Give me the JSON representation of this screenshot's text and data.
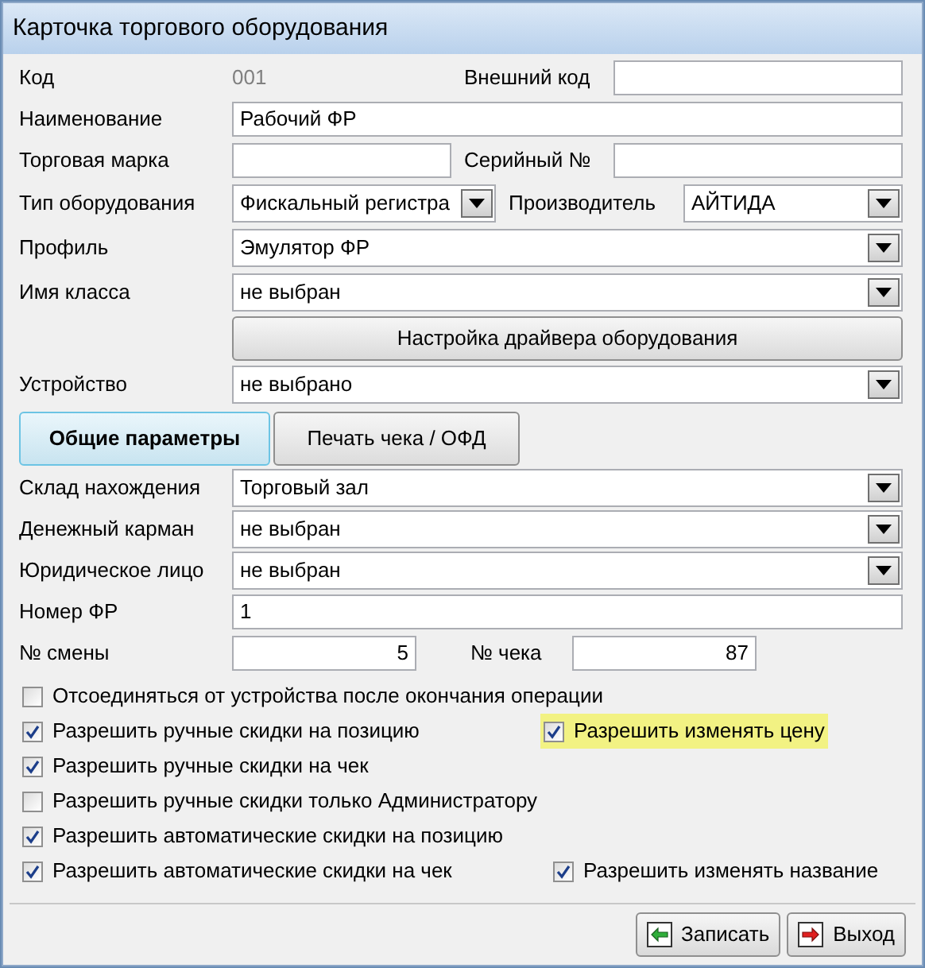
{
  "window": {
    "title": "Карточка торгового оборудования"
  },
  "code": {
    "label": "Код",
    "value": "001"
  },
  "external_code": {
    "label": "Внешний код"
  },
  "name": {
    "label": "Наименование",
    "value": "Рабочий ФР"
  },
  "brand": {
    "label": "Торговая марка"
  },
  "serial": {
    "label": "Серийный №"
  },
  "equipment_type": {
    "label": "Тип оборудования",
    "value": "Фискальный регистра"
  },
  "manufacturer": {
    "label": "Производитель",
    "value": "АЙТИДА"
  },
  "profile": {
    "label": "Профиль",
    "value": "Эмулятор ФР"
  },
  "class_name": {
    "label": "Имя класса",
    "value": "не выбран"
  },
  "driver_button": {
    "label": "Настройка драйвера оборудования"
  },
  "device": {
    "label": "Устройство",
    "value": "не выбрано"
  },
  "tabs": [
    {
      "label": "Общие параметры",
      "selected": true
    },
    {
      "label": "Печать чека / ОФД",
      "selected": false
    }
  ],
  "selects": [
    {
      "label": "Склад нахождения",
      "value": "Торговый зал"
    },
    {
      "label": "Денежный карман",
      "value": "не выбран"
    },
    {
      "label": "Юридическое лицо",
      "value": "не выбран"
    }
  ],
  "fr_number": {
    "label": "Номер ФР",
    "value": "1"
  },
  "shift": {
    "label": "№ смены",
    "value": "5"
  },
  "receipt": {
    "label": "№ чека",
    "value": "87"
  },
  "option_rows": [
    {
      "left": {
        "label": "Отсоединяться от устройства после окончания операции",
        "checked": false
      }
    },
    {
      "left": {
        "label": "Разрешить ручные скидки на позицию",
        "checked": true
      },
      "right": {
        "label": "Разрешить изменять цену",
        "checked": true,
        "highlighted": true
      }
    },
    {
      "left": {
        "label": "Разрешить ручные скидки на чек",
        "checked": true
      }
    },
    {
      "left": {
        "label": "Разрешить ручные скидки только Администратору",
        "checked": false
      }
    },
    {
      "left": {
        "label": "Разрешить автоматические скидки на позицию",
        "checked": true
      }
    },
    {
      "left": {
        "label": "Разрешить автоматические скидки на чек",
        "checked": true
      },
      "right": {
        "label": "Разрешить изменять название",
        "checked": true,
        "highlighted": false
      }
    }
  ],
  "buttons": [
    {
      "label": "Записать",
      "kind": "save"
    },
    {
      "label": "Выход",
      "kind": "exit"
    }
  ]
}
